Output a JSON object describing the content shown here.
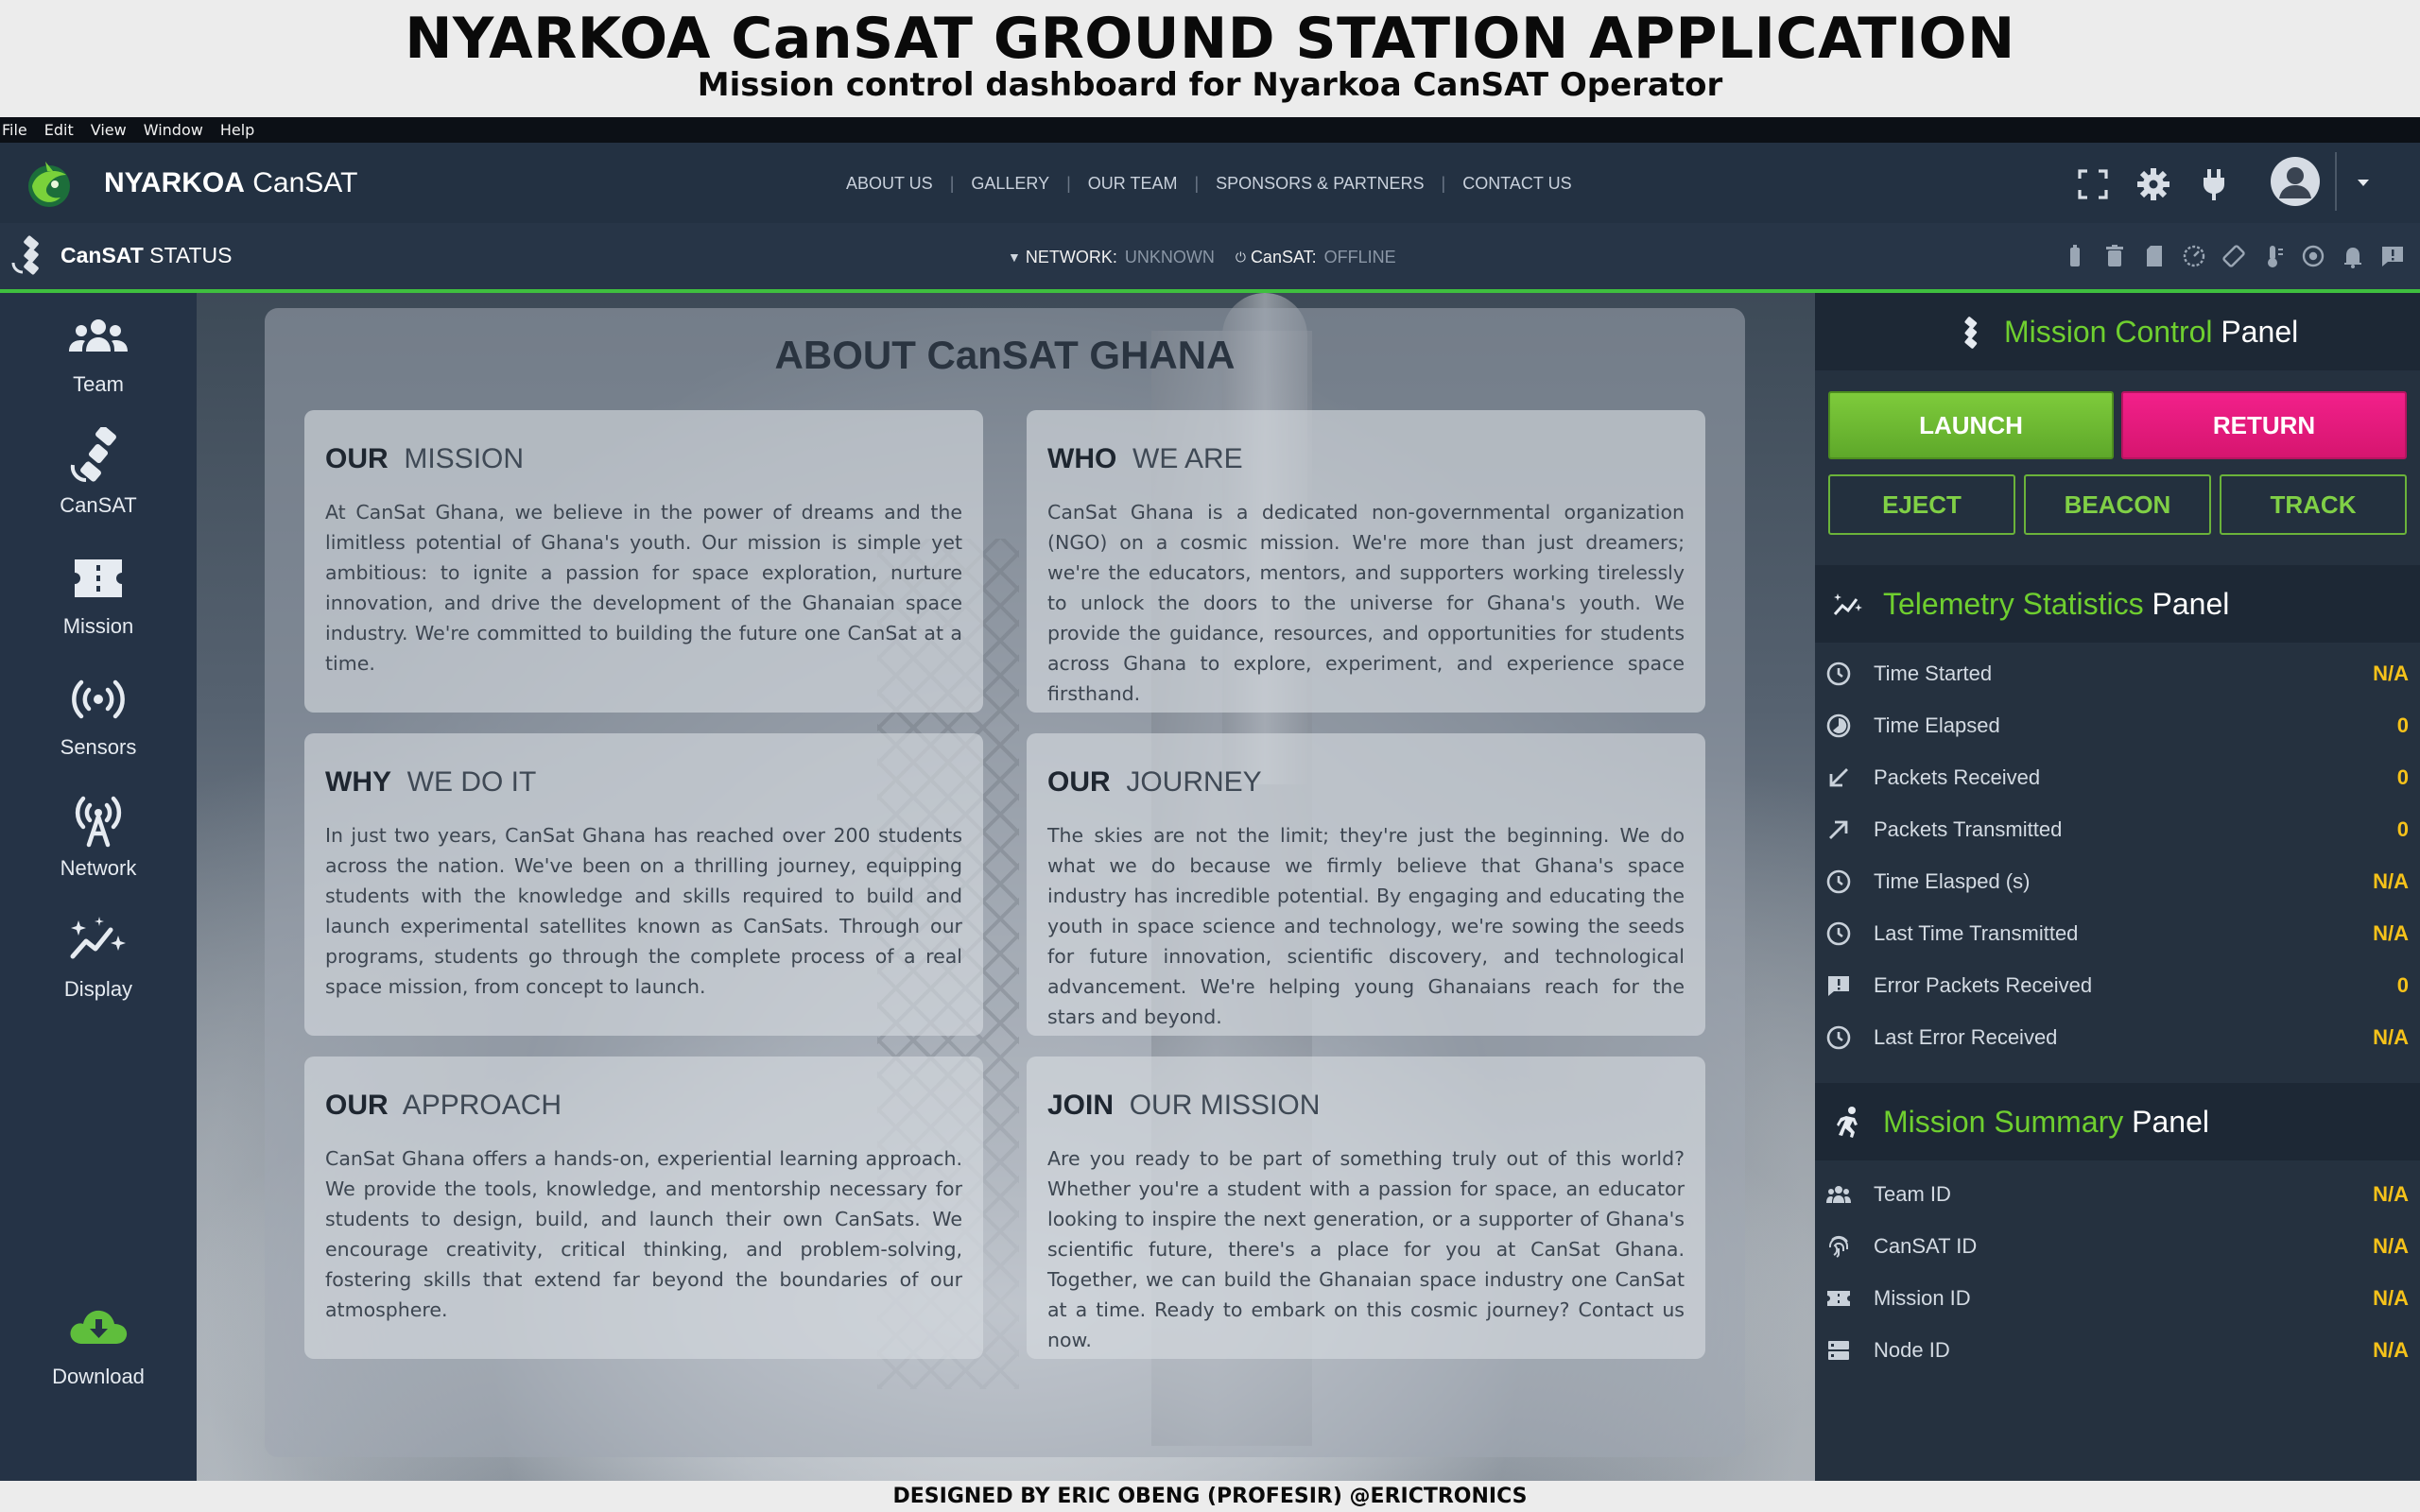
{
  "banner": {
    "title": "NYARKOA CanSAT GROUND STATION APPLICATION",
    "subtitle": "Mission control dashboard for Nyarkoa CanSAT Operator"
  },
  "menubar": [
    "File",
    "Edit",
    "View",
    "Window",
    "Help"
  ],
  "navbar": {
    "brand_bold": "NYARKOA",
    "brand_rest": "CanSAT",
    "links": [
      "ABOUT US",
      "GALLERY",
      "OUR TEAM",
      "SPONSORS & PARTNERS",
      "CONTACT US"
    ],
    "separator": "|",
    "icons": [
      "fullscreen-icon",
      "gear-icon",
      "plug-icon",
      "avatar",
      "caret-down-icon"
    ]
  },
  "statusbar": {
    "title_bold": "CanSAT",
    "title_rest": "STATUS",
    "network_label": "NETWORK:",
    "network_value": "UNKNOWN",
    "cansat_label": "CanSAT:",
    "cansat_value": "OFFLINE",
    "icons": [
      "battery-icon",
      "trash-icon",
      "sd-card-icon",
      "speed-icon",
      "rotate-icon",
      "thermometer-icon",
      "gauge-icon",
      "bell-icon",
      "alert-message-icon"
    ]
  },
  "sidebar": {
    "items": [
      {
        "label": "Team",
        "icon": "team-icon"
      },
      {
        "label": "CanSAT",
        "icon": "satellite-icon"
      },
      {
        "label": "Mission",
        "icon": "mission-icon"
      },
      {
        "label": "Sensors",
        "icon": "sensors-icon"
      },
      {
        "label": "Network",
        "icon": "network-icon"
      },
      {
        "label": "Display",
        "icon": "display-icon"
      },
      {
        "label": "Download",
        "icon": "download-icon"
      }
    ]
  },
  "about": {
    "title": "ABOUT CanSAT GHANA",
    "cards": [
      {
        "bold": "OUR",
        "rest": "MISSION",
        "text": "At CanSat Ghana, we believe in the power of dreams and the limitless potential of Ghana's youth. Our mission is simple yet ambitious: to ignite a passion for space exploration, nurture innovation, and drive the development of the Ghanaian space industry. We're committed to building the future one CanSat at a time."
      },
      {
        "bold": "WHO",
        "rest": "WE ARE",
        "text": "CanSat Ghana is a dedicated non-governmental organization (NGO) on a cosmic mission. We're more than just dreamers; we're the educators, mentors, and supporters working tirelessly to unlock the doors to the universe for Ghana's youth. We provide the guidance, resources, and opportunities for students across Ghana to explore, experiment, and experience space firsthand."
      },
      {
        "bold": "WHY",
        "rest": "WE DO IT",
        "text": "In just two years, CanSat Ghana has reached over 200 students across the nation. We've been on a thrilling journey, equipping students with the knowledge and skills required to build and launch experimental satellites known as CanSats. Through our programs, students go through the complete process of a real space mission, from concept to launch."
      },
      {
        "bold": "OUR",
        "rest": "JOURNEY",
        "text": "The skies are not the limit; they're just the beginning. We do what we do because we firmly believe that Ghana's space industry has incredible potential. By engaging and educating the youth in space science and technology, we're sowing the seeds for future innovation, scientific discovery, and technological advancement. We're helping young Ghanaians reach for the stars and beyond."
      },
      {
        "bold": "OUR",
        "rest": "APPROACH",
        "text": "CanSat Ghana offers a hands-on, experiential learning approach. We provide the tools, knowledge, and mentorship necessary for students to design, build, and launch their own CanSats. We encourage creativity, critical thinking, and problem-solving, fostering skills that extend far beyond the boundaries of our atmosphere."
      },
      {
        "bold": "JOIN",
        "rest": "OUR MISSION",
        "text": "Are you ready to be part of something truly out of this world? Whether you're a student with a passion for space, an educator looking to inspire the next generation, or a supporter of Ghana's scientific future, there's a place for you at CanSat Ghana. Together, we can build the Ghanaian space industry one CanSat at a time. Ready to embark on this cosmic journey? Contact us now."
      }
    ]
  },
  "mission_control": {
    "title_green": "Mission Control",
    "title_rest": "Panel",
    "launch": "LAUNCH",
    "return": "RETURN",
    "eject": "EJECT",
    "beacon": "BEACON",
    "track": "TRACK"
  },
  "telemetry": {
    "title_green": "Telemetry Statistics",
    "title_rest": "Panel",
    "rows": [
      {
        "label": "Time Started",
        "value": "N/A",
        "icon": "clock-icon"
      },
      {
        "label": "Time Elapsed",
        "value": "0",
        "icon": "timelapse-icon"
      },
      {
        "label": "Packets Received",
        "value": "0",
        "icon": "arrow-down-left-icon"
      },
      {
        "label": "Packets Transmitted",
        "value": "0",
        "icon": "arrow-up-right-icon"
      },
      {
        "label": "Time Elasped (s)",
        "value": "N/A",
        "icon": "clock-icon"
      },
      {
        "label": "Last Time Transmitted",
        "value": "N/A",
        "icon": "clock-icon"
      },
      {
        "label": "Error Packets Received",
        "value": "0",
        "icon": "error-message-icon"
      },
      {
        "label": "Last Error Received",
        "value": "N/A",
        "icon": "clock-icon"
      }
    ]
  },
  "summary": {
    "title_green": "Mission Summary",
    "title_rest": "Panel",
    "rows": [
      {
        "label": "Team ID",
        "value": "N/A",
        "icon": "team-icon"
      },
      {
        "label": "CanSAT ID",
        "value": "N/A",
        "icon": "fingerprint-icon"
      },
      {
        "label": "Mission ID",
        "value": "N/A",
        "icon": "ticket-icon"
      },
      {
        "label": "Node ID",
        "value": "N/A",
        "icon": "server-icon"
      }
    ]
  },
  "colors": {
    "accent_green": "#6fcf2f",
    "launch": "#6cbb33",
    "return": "#e8197c",
    "value_yellow": "#f6c21a",
    "panel_bg": "#25313f",
    "status_line": "#3fbf3f"
  },
  "footer": "DESIGNED BY ERIC OBENG (PROFESIR) @ERICTRONICS"
}
